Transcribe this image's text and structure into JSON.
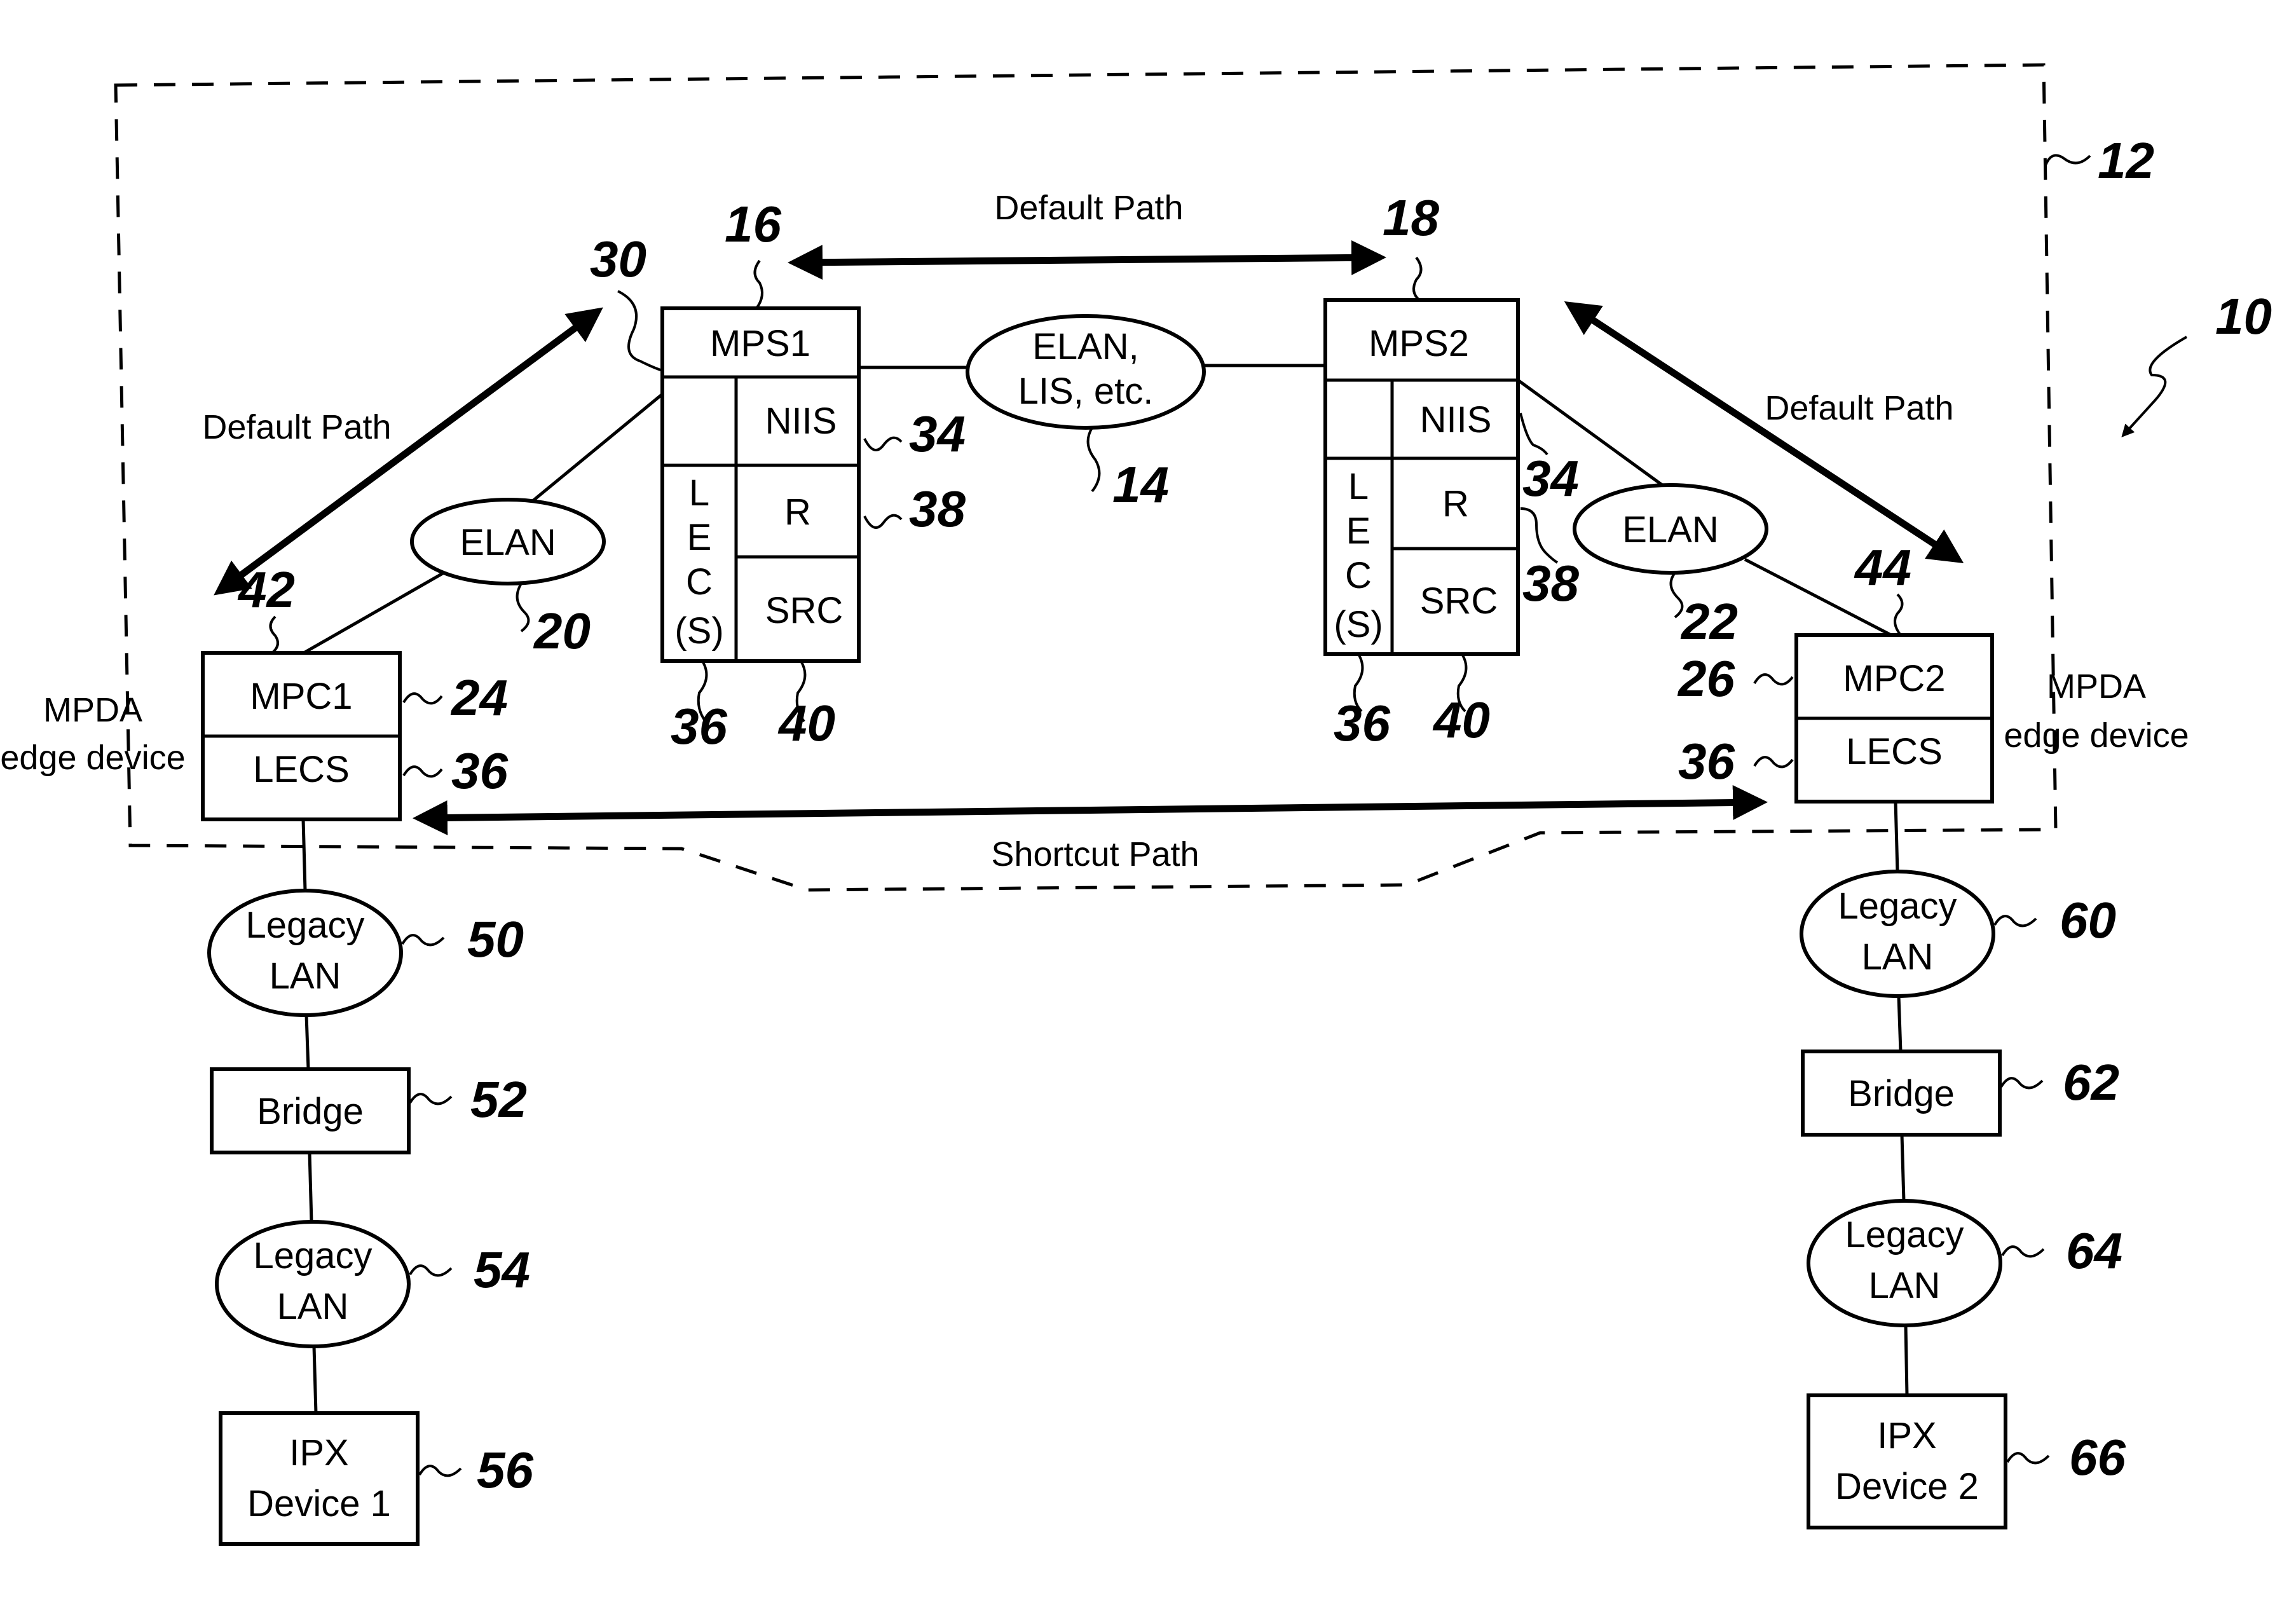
{
  "figure": {
    "system_ref": "10",
    "boundary_ref": "12",
    "center_network": {
      "line1": "ELAN,",
      "line2": "LIS, etc.",
      "ref": "14"
    },
    "mps1": {
      "title": "MPS1",
      "ref": "16",
      "niis": "NIIS",
      "niis_ref": "34",
      "r": "R",
      "r_ref": "38",
      "src": "SRC",
      "src_ref": "40",
      "lec": [
        "L",
        "E",
        "C",
        "(S)"
      ],
      "lec_ref": "36",
      "port_ref": "30"
    },
    "mps2": {
      "title": "MPS2",
      "ref": "18",
      "niis": "NIIS",
      "niis_ref": "34",
      "r": "R",
      "r_ref": "38",
      "src": "SRC",
      "src_ref": "40",
      "lec": [
        "L",
        "E",
        "C",
        "(S)"
      ],
      "lec_ref": "36"
    },
    "elan_left": {
      "label": "ELAN",
      "ref": "20"
    },
    "elan_right": {
      "label": "ELAN",
      "ref": "22"
    },
    "mpc1": {
      "title": "MPC1",
      "ref": "24",
      "lecs": "LECS",
      "lecs_ref": "36",
      "port_ref": "42",
      "caption_line1": "MPDA",
      "caption_line2": "edge device"
    },
    "mpc2": {
      "title": "MPC2",
      "ref": "26",
      "lecs": "LECS",
      "lecs_ref": "36",
      "port_ref": "44",
      "caption_line1": "MPDA",
      "caption_line2": "edge device"
    },
    "paths": {
      "default_top": "Default Path",
      "default_left": "Default Path",
      "default_right": "Default Path",
      "shortcut": "Shortcut Path"
    },
    "left_chain": {
      "lan1": {
        "line1": "Legacy",
        "line2": "LAN",
        "ref": "50"
      },
      "bridge": {
        "label": "Bridge",
        "ref": "52"
      },
      "lan2": {
        "line1": "Legacy",
        "line2": "LAN",
        "ref": "54"
      },
      "device": {
        "line1": "IPX",
        "line2": "Device 1",
        "ref": "56"
      }
    },
    "right_chain": {
      "lan1": {
        "line1": "Legacy",
        "line2": "LAN",
        "ref": "60"
      },
      "bridge": {
        "label": "Bridge",
        "ref": "62"
      },
      "lan2": {
        "line1": "Legacy",
        "line2": "LAN",
        "ref": "64"
      },
      "device": {
        "line1": "IPX",
        "line2": "Device 2",
        "ref": "66"
      }
    }
  }
}
